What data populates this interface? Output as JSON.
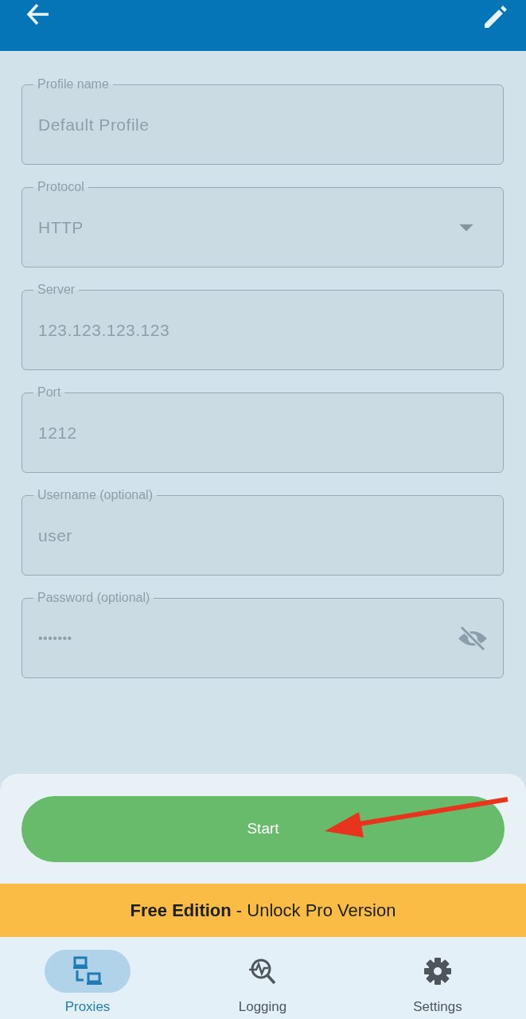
{
  "fields": [
    {
      "kind": "text",
      "label": "Profile name",
      "value": "Default Profile"
    },
    {
      "kind": "select",
      "label": "Protocol",
      "value": "HTTP"
    },
    {
      "kind": "text",
      "label": "Server",
      "value": "123.123.123.123"
    },
    {
      "kind": "text",
      "label": "Port",
      "value": "1212"
    },
    {
      "kind": "text",
      "label": "Username (optional)",
      "value": "user"
    },
    {
      "kind": "password",
      "label": "Password (optional)",
      "value": "•••••••"
    }
  ],
  "start_button": "Start",
  "banner": "**Free Edition** - Unlock Pro Version",
  "nav": [
    {
      "kind": "proxies",
      "label": "Proxies",
      "selected": true
    },
    {
      "kind": "logging",
      "label": "Logging",
      "selected": false
    },
    {
      "kind": "settings",
      "label": "Settings",
      "selected": false
    }
  ]
}
